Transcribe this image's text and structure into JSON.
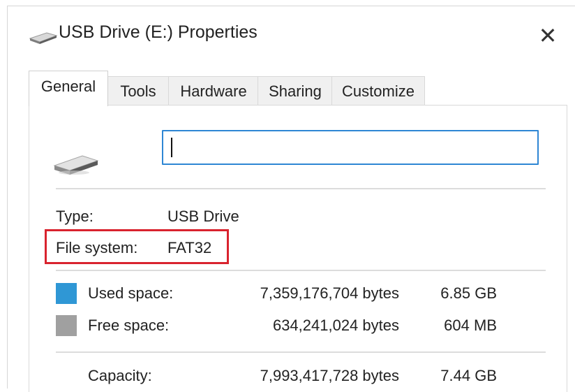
{
  "window": {
    "title": "USB Drive (E:) Properties",
    "close_label": "✕"
  },
  "tabs": [
    {
      "label": "General",
      "active": true
    },
    {
      "label": "Tools"
    },
    {
      "label": "Hardware"
    },
    {
      "label": "Sharing"
    },
    {
      "label": "Customize"
    }
  ],
  "general": {
    "drive_name_value": "",
    "type": {
      "label": "Type:",
      "value": "USB Drive"
    },
    "file_system": {
      "label": "File system:",
      "value": "FAT32"
    },
    "used_space": {
      "label": "Used space:",
      "bytes": "7,359,176,704 bytes",
      "size": "6.85 GB",
      "color": "#2f97d5"
    },
    "free_space": {
      "label": "Free space:",
      "bytes": "634,241,024 bytes",
      "size": "604 MB",
      "color": "#a0a0a0"
    },
    "capacity": {
      "label": "Capacity:",
      "bytes": "7,993,417,728 bytes",
      "size": "7.44 GB"
    }
  },
  "icons": {
    "title_icon": "usb-drive-icon",
    "drive_icon": "usb-drive-icon"
  },
  "highlight_color": "#d9232e"
}
